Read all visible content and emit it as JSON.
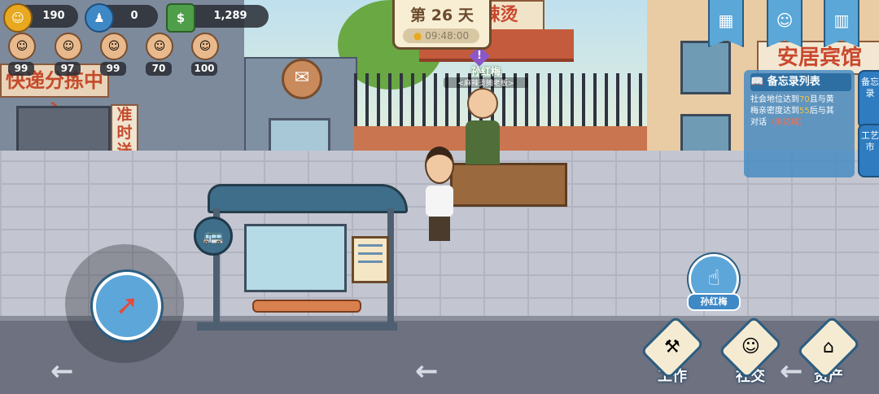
{
  "hud": {
    "resources": [
      {
        "icon": "gold-coin-icon",
        "symbol": "☺",
        "value": "190"
      },
      {
        "icon": "fame-icon",
        "symbol": "♟",
        "value": "0"
      },
      {
        "icon": "cash-icon",
        "symbol": "$",
        "value": "1,289"
      }
    ],
    "stats": [
      {
        "icon": "stat-health-icon",
        "value": "99"
      },
      {
        "icon": "stat-mood-icon",
        "value": "97"
      },
      {
        "icon": "stat-energy-icon",
        "value": "99"
      },
      {
        "icon": "stat-charm-icon",
        "value": "70"
      },
      {
        "icon": "stat-skill-icon",
        "value": "100"
      }
    ],
    "day_label": "第 26 天",
    "time": "09:48:00"
  },
  "scene": {
    "shop_sign": "辣烫",
    "depot_sign": "快递分拣中心",
    "depot_vsign": "准时送达",
    "hotel_sign": "安居宾馆"
  },
  "npc": {
    "name": "孙红梅",
    "title": "<麻辣烫摊老板>",
    "talk_name": "孙红梅"
  },
  "memo": {
    "title": "备忘录列表",
    "line1_a": "社会地位达到",
    "line1_b": "70",
    "line1_c": "且与黄",
    "line2_a": "梅亲密度达到",
    "line2_b": "55",
    "line2_c": "后与其",
    "line3_a": "对话",
    "line3_b": "（未达成）"
  },
  "side_tabs": [
    "备忘录",
    "工艺市"
  ],
  "menu": [
    {
      "icon": "work-icon",
      "symbol": "⚒",
      "label": "工作"
    },
    {
      "icon": "social-icon",
      "symbol": "☺",
      "label": "社交"
    },
    {
      "icon": "assets-icon",
      "symbol": "⌂",
      "label": "资产"
    }
  ],
  "colors": {
    "accent": "#5da6d9",
    "highlight": "#f0c24a",
    "warning": "#ff6b4a"
  }
}
